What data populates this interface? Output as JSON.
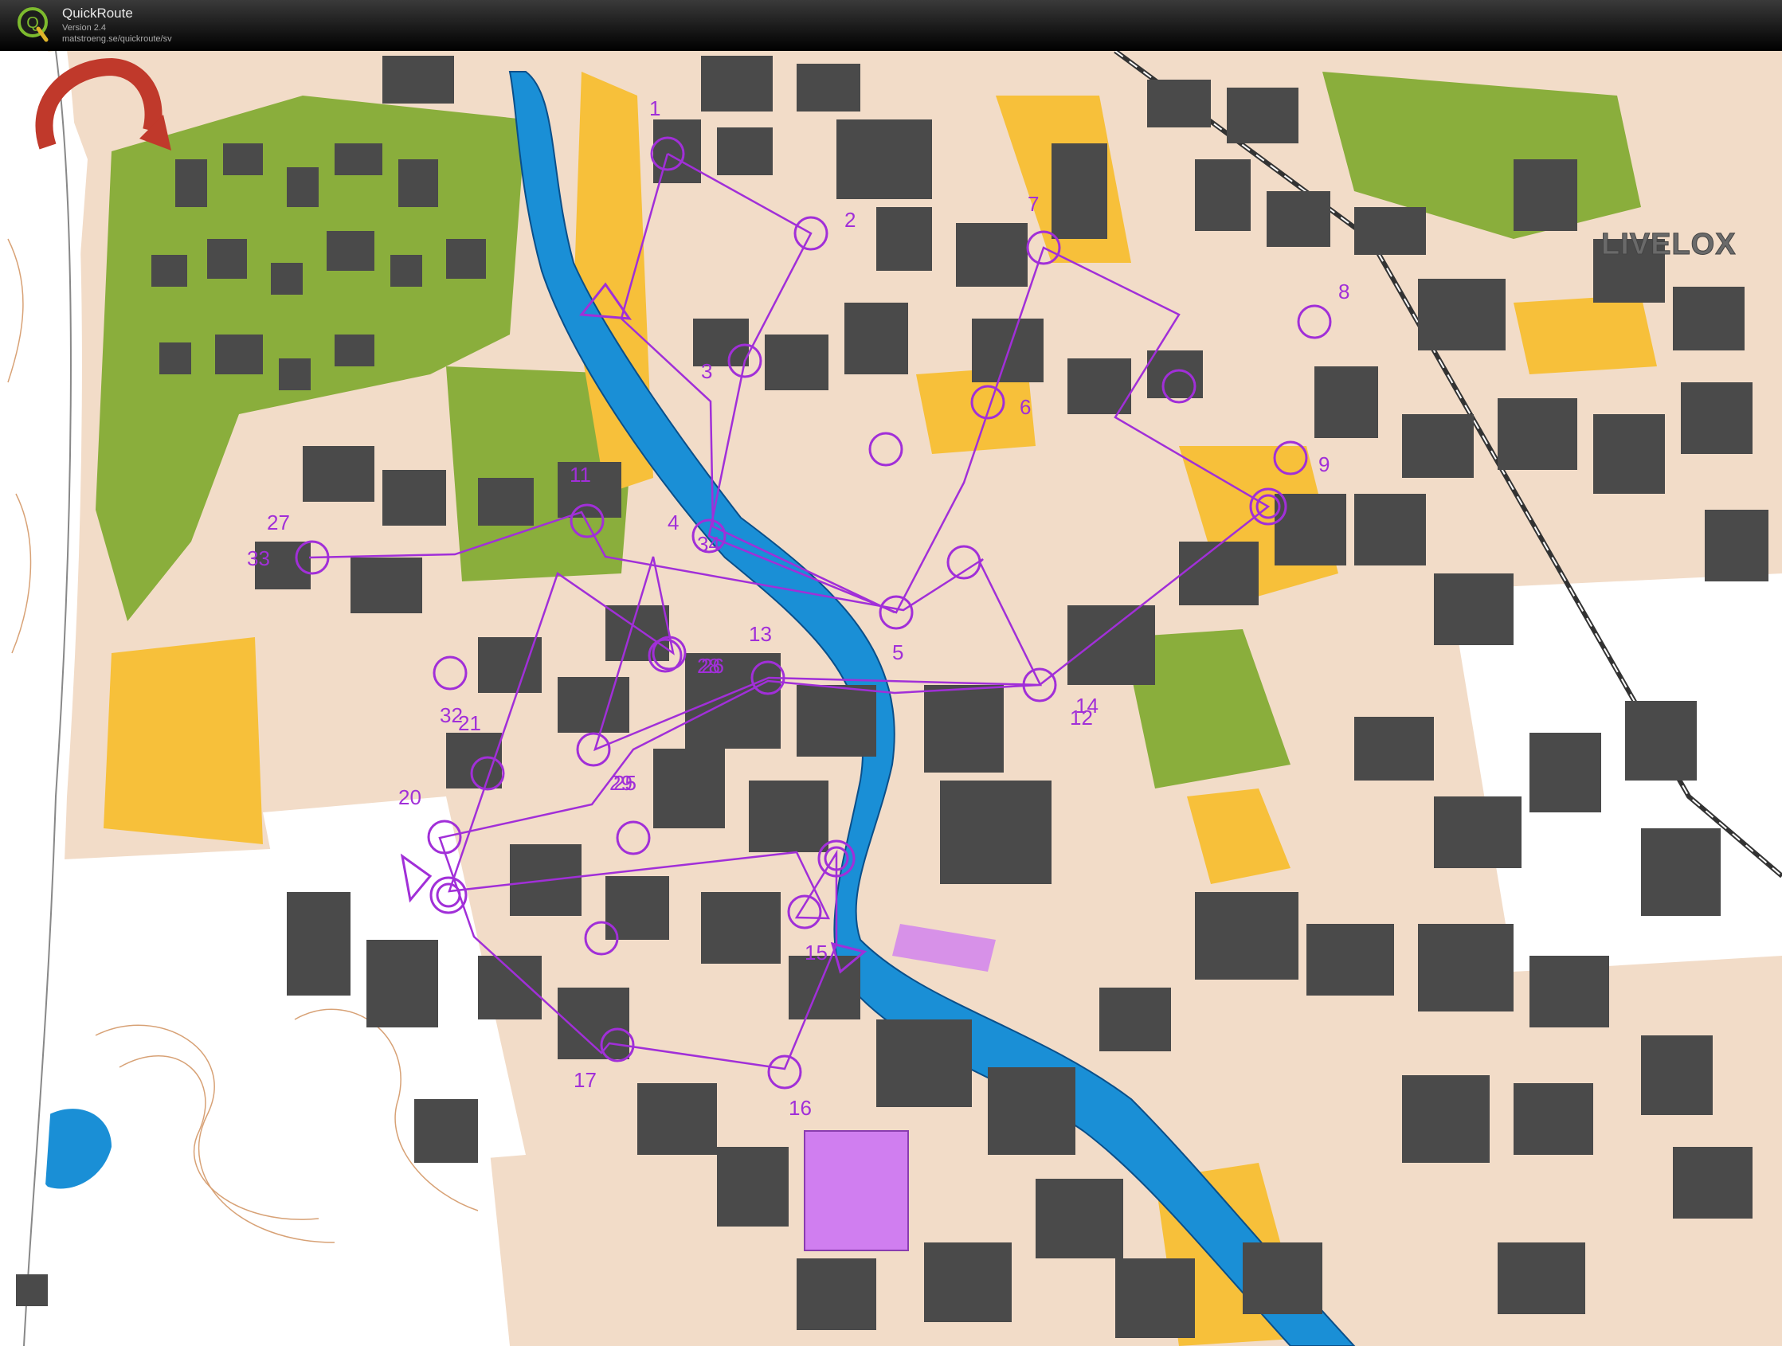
{
  "app": {
    "name": "QuickRoute",
    "version": "Version 2.4",
    "url": "matstroeng.se/quickroute/sv",
    "logo_letter": "Q"
  },
  "overlay": {
    "brand": "LIVELOX"
  },
  "colors": {
    "road": "#f2dcc8",
    "building": "#4a4a4a",
    "forest_green": "#8aae3c",
    "open_yellow": "#f7c03a",
    "water": "#1a8fd6",
    "course": "#a12fd8",
    "restricted_purple": "#d07ef0"
  },
  "course": {
    "labels": [
      "1",
      "2",
      "3",
      "4",
      "5",
      "6",
      "7",
      "8",
      "9",
      "11",
      "12",
      "13",
      "14",
      "15",
      "16",
      "17",
      "20",
      "21",
      "25",
      "26",
      "27",
      "28",
      "29",
      "32",
      "33",
      "34"
    ]
  }
}
